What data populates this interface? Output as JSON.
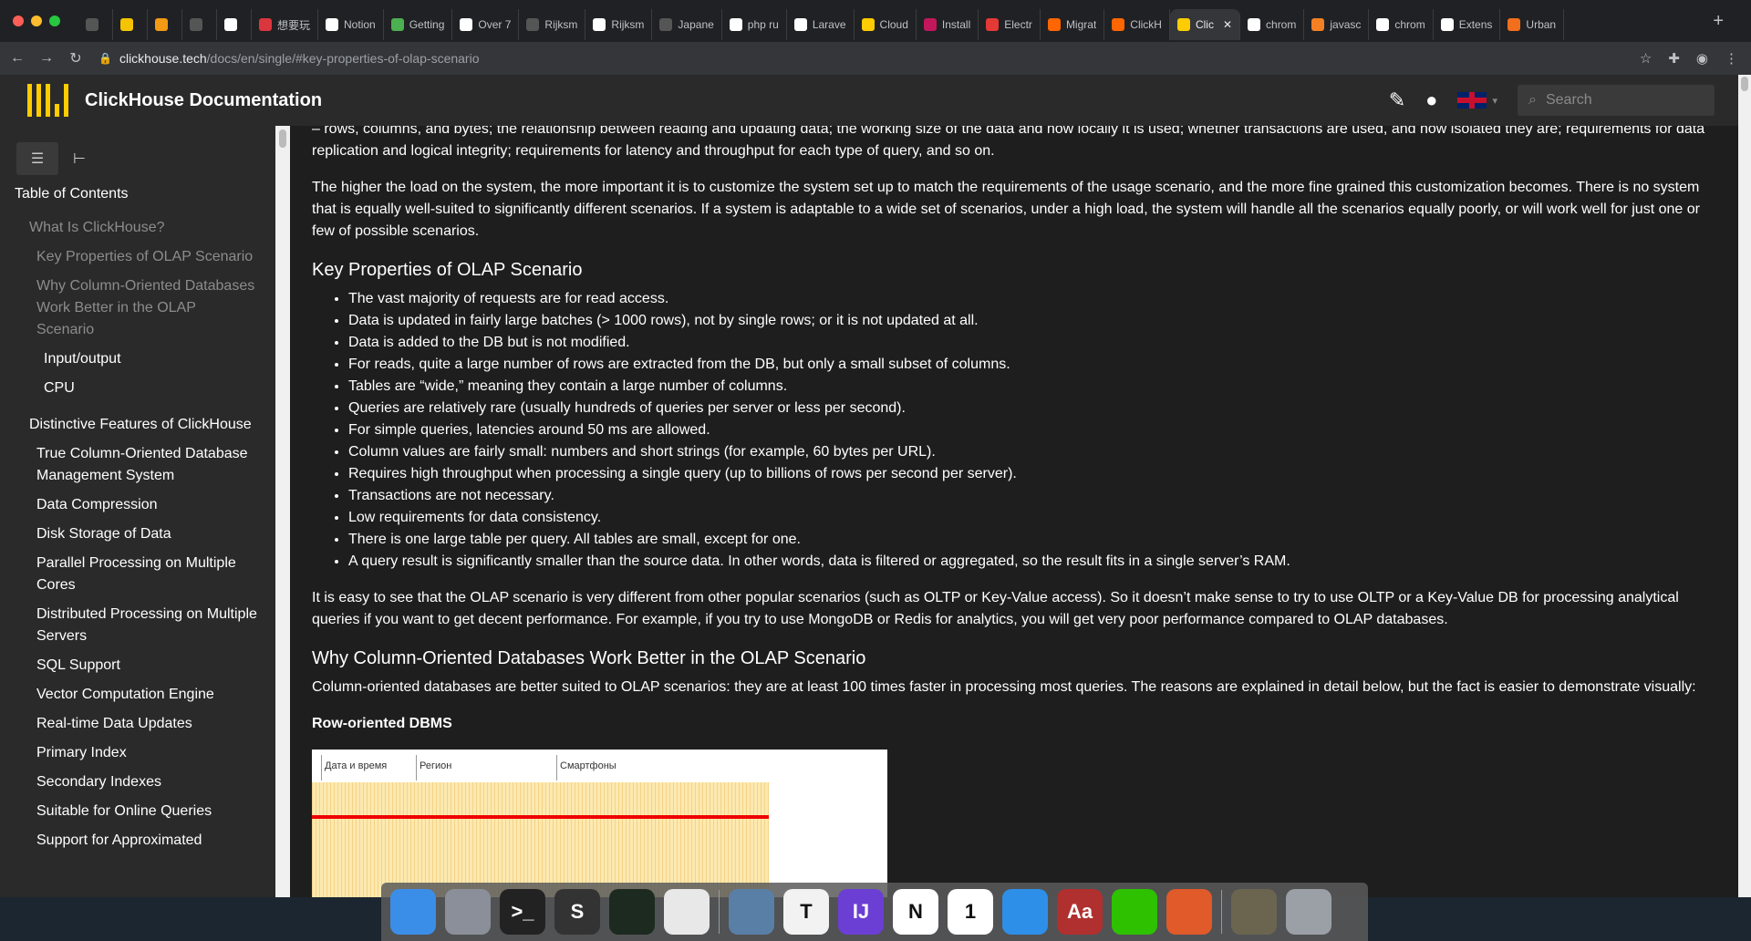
{
  "browser": {
    "tabs": [
      {
        "label": "",
        "icon": "circle-slash-icon",
        "color": "#555"
      },
      {
        "label": "",
        "icon": "smiley-icon",
        "color": "#f5c400"
      },
      {
        "label": "",
        "icon": "orange-icon",
        "color": "#f29a14"
      },
      {
        "label": "",
        "icon": "circle-slash-icon",
        "color": "#555"
      },
      {
        "label": "",
        "icon": "notion-icon",
        "color": "#ffffff"
      },
      {
        "label": "想要玩",
        "icon": "red-app-icon",
        "color": "#d9363e"
      },
      {
        "label": "Notion",
        "icon": "notion-icon",
        "color": "#ffffff"
      },
      {
        "label": "Getting",
        "icon": "green-leaf-icon",
        "color": "#4caf50"
      },
      {
        "label": "Over 7",
        "icon": "w-icon",
        "color": "#ffffff"
      },
      {
        "label": "Rijksm",
        "icon": "dash-icon",
        "color": "#555"
      },
      {
        "label": "Rijksm",
        "icon": "github-icon",
        "color": "#ffffff"
      },
      {
        "label": "Japane",
        "icon": "dash-icon",
        "color": "#555"
      },
      {
        "label": "php ru",
        "icon": "google-icon",
        "color": "#ffffff"
      },
      {
        "label": "Larave",
        "icon": "google-icon",
        "color": "#ffffff"
      },
      {
        "label": "Cloud",
        "icon": "clickhouse-icon",
        "color": "#fc0"
      },
      {
        "label": "Install",
        "icon": "heart-icon",
        "color": "#c2185b"
      },
      {
        "label": "Electr",
        "icon": "grid-icon",
        "color": "#e53935"
      },
      {
        "label": "Migrat",
        "icon": "y-icon",
        "color": "#ff6600"
      },
      {
        "label": "ClickH",
        "icon": "y-icon",
        "color": "#ff6600"
      },
      {
        "label": "Clic",
        "icon": "clickhouse-icon",
        "color": "#fc0",
        "active": true
      },
      {
        "label": "chrom",
        "icon": "google-icon",
        "color": "#ffffff"
      },
      {
        "label": "javasc",
        "icon": "stack-icon",
        "color": "#f48024"
      },
      {
        "label": "chrom",
        "icon": "github-icon",
        "color": "#ffffff"
      },
      {
        "label": "Extens",
        "icon": "puzzle-icon",
        "color": "#ffffff"
      },
      {
        "label": "Urban",
        "icon": "ud-icon",
        "color": "#f16f1d"
      }
    ],
    "new_tab": "+",
    "url_host": "clickhouse.tech",
    "url_path": "/docs/en/single/#key-properties-of-olap-scenario"
  },
  "site": {
    "title": "ClickHouse Documentation",
    "search_placeholder": "Search",
    "logo_color": "#ffcc00"
  },
  "sidebar": {
    "toc_title": "Table of Contents",
    "items": [
      {
        "label": "What Is ClickHouse?",
        "level": 0,
        "state": "dim"
      },
      {
        "label": "Key Properties of OLAP Scenario",
        "level": 1,
        "state": "dim"
      },
      {
        "label": "Why Column-Oriented Databases Work Better in the OLAP Scenario",
        "level": 1,
        "state": "dim"
      },
      {
        "label": "Input/output",
        "level": 2,
        "state": "bright"
      },
      {
        "label": "CPU",
        "level": 2,
        "state": "bright"
      },
      {
        "label": "Distinctive Features of ClickHouse",
        "level": 0,
        "state": "bright",
        "gap": true
      },
      {
        "label": "True Column-Oriented Database Management System",
        "level": 1,
        "state": "bright"
      },
      {
        "label": "Data Compression",
        "level": 1,
        "state": "bright"
      },
      {
        "label": "Disk Storage of Data",
        "level": 1,
        "state": "bright"
      },
      {
        "label": "Parallel Processing on Multiple Cores",
        "level": 1,
        "state": "bright"
      },
      {
        "label": "Distributed Processing on Multiple Servers",
        "level": 1,
        "state": "bright"
      },
      {
        "label": "SQL Support",
        "level": 1,
        "state": "bright"
      },
      {
        "label": "Vector Computation Engine",
        "level": 1,
        "state": "bright"
      },
      {
        "label": "Real-time Data Updates",
        "level": 1,
        "state": "bright"
      },
      {
        "label": "Primary Index",
        "level": 1,
        "state": "bright"
      },
      {
        "label": "Secondary Indexes",
        "level": 1,
        "state": "bright"
      },
      {
        "label": "Suitable for Online Queries",
        "level": 1,
        "state": "bright"
      },
      {
        "label": "Support for Approximated",
        "level": 1,
        "state": "bright"
      }
    ]
  },
  "content": {
    "intro_tail": "– rows, columns, and bytes; the relationship between reading and updating data; the working size of the data and how locally it is used; whether transactions are used, and how isolated they are; requirements for data replication and logical integrity; requirements for latency and throughput for each type of query, and so on.",
    "para_load": "The higher the load on the system, the more important it is to customize the system set up to match the requirements of the usage scenario, and the more fine grained this customization becomes. There is no system that is equally well-suited to significantly different scenarios. If a system is adaptable to a wide set of scenarios, under a high load, the system will handle all the scenarios equally poorly, or will work well for just one or few of possible scenarios.",
    "h_key": "Key Properties of OLAP Scenario",
    "key_list": [
      "The vast majority of requests are for read access.",
      "Data is updated in fairly large batches (> 1000 rows), not by single rows; or it is not updated at all.",
      "Data is added to the DB but is not modified.",
      "For reads, quite a large number of rows are extracted from the DB, but only a small subset of columns.",
      "Tables are “wide,” meaning they contain a large number of columns.",
      "Queries are relatively rare (usually hundreds of queries per server or less per second).",
      "For simple queries, latencies around 50 ms are allowed.",
      "Column values are fairly small: numbers and short strings (for example, 60 bytes per URL).",
      "Requires high throughput when processing a single query (up to billions of rows per second per server).",
      "Transactions are not necessary.",
      "Low requirements for data consistency.",
      "There is one large table per query. All tables are small, except for one.",
      "A query result is significantly smaller than the source data. In other words, data is filtered or aggregated, so the result fits in a single server’s RAM."
    ],
    "para_easy": "It is easy to see that the OLAP scenario is very different from other popular scenarios (such as OLTP or Key-Value access). So it doesn’t make sense to try to use OLTP or a Key-Value DB for processing analytical queries if you want to get decent performance. For example, if you try to use MongoDB or Redis for analytics, you will get very poor performance compared to OLAP databases.",
    "h_why": "Why Column-Oriented Databases Work Better in the OLAP Scenario",
    "para_col": "Column-oriented databases are better suited to OLAP scenarios: they are at least 100 times faster in processing most queries. The reasons are explained in detail below, but the fact is easier to demonstrate visually:",
    "h_row": "Row-oriented DBMS",
    "figure_cols": [
      "Дата и время",
      "Регион",
      "Смартфоны"
    ]
  },
  "dock": {
    "apps": [
      {
        "name": "finder",
        "color": "#3b8ee8",
        "glyph": ""
      },
      {
        "name": "launchpad",
        "color": "#8a8f99",
        "glyph": ""
      },
      {
        "name": "terminal",
        "color": "#222222",
        "glyph": ">_"
      },
      {
        "name": "sublime-text",
        "color": "#333333",
        "glyph": "S"
      },
      {
        "name": "activity-monitor",
        "color": "#1c2a20",
        "glyph": ""
      },
      {
        "name": "chrome",
        "color": "#e8e8e8",
        "glyph": ""
      },
      {
        "name": "preview",
        "color": "#5a7fa6",
        "glyph": ""
      },
      {
        "name": "typora",
        "color": "#f2f2f2",
        "glyph": "T"
      },
      {
        "name": "intellij",
        "color": "#6b3fd4",
        "glyph": "IJ"
      },
      {
        "name": "notion",
        "color": "#ffffff",
        "glyph": "N"
      },
      {
        "name": "calendar",
        "color": "#ffffff",
        "glyph": "1"
      },
      {
        "name": "qq",
        "color": "#2e8fe8",
        "glyph": ""
      },
      {
        "name": "dictionary",
        "color": "#b03030",
        "glyph": "Aa"
      },
      {
        "name": "wechat",
        "color": "#2dc100",
        "glyph": ""
      },
      {
        "name": "pock",
        "color": "#e05a2a",
        "glyph": ""
      },
      {
        "name": "photos-stack",
        "color": "#6b6550",
        "glyph": ""
      },
      {
        "name": "trash",
        "color": "#9aa0a6",
        "glyph": ""
      }
    ],
    "calendar_month": "FEB",
    "calendar_day": "1"
  }
}
